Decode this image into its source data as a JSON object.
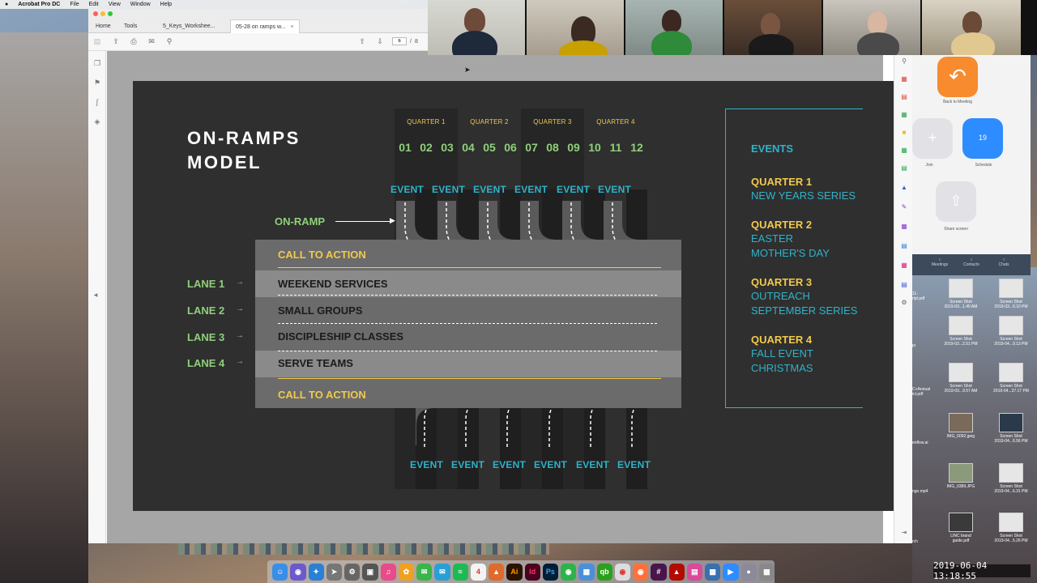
{
  "menubar": {
    "app": "Acrobat Pro DC",
    "items": [
      "File",
      "Edit",
      "View",
      "Window",
      "Help"
    ]
  },
  "acrobat": {
    "tabs": [
      {
        "label": "Home"
      },
      {
        "label": "Tools"
      },
      {
        "label": "5_Keys_Workshee..."
      },
      {
        "label": "05-28 on ramps w..."
      }
    ],
    "close_glyph": "×",
    "pager": {
      "current": "6",
      "separator": "/",
      "total": "8"
    }
  },
  "slide": {
    "title_line1": "ON-RAMPS",
    "title_line2": "MODEL",
    "quarters": [
      "QUARTER 1",
      "QUARTER 2",
      "QUARTER 3",
      "QUARTER 4"
    ],
    "months": [
      "01",
      "02",
      "03",
      "04",
      "05",
      "06",
      "07",
      "08",
      "09",
      "10",
      "11",
      "12"
    ],
    "event_label": "EVENT",
    "onramp_label": "ON-RAMP",
    "cta_top": "CALL TO ACTION",
    "cta_bottom": "CALL TO ACTION",
    "lanes": [
      {
        "label": "LANE 1",
        "name": "WEEKEND SERVICES"
      },
      {
        "label": "LANE 2",
        "name": "SMALL GROUPS"
      },
      {
        "label": "LANE 3",
        "name": "DISCIPLESHIP CLASSES"
      },
      {
        "label": "LANE 4",
        "name": "SERVE TEAMS"
      }
    ],
    "events_panel": {
      "title": "EVENTS",
      "quarters": [
        {
          "q": "QUARTER 1",
          "items": [
            "NEW YEARS SERIES"
          ]
        },
        {
          "q": "QUARTER 2",
          "items": [
            "EASTER",
            "MOTHER'S DAY"
          ]
        },
        {
          "q": "QUARTER 3",
          "items": [
            "OUTREACH",
            "SEPTEMBER SERIES"
          ]
        },
        {
          "q": "QUARTER 4",
          "items": [
            "FALL EVENT",
            "CHRISTMAS"
          ]
        }
      ]
    }
  },
  "zoom": {
    "back_label": "Back to Meeting",
    "join_label": "Join",
    "schedule_label": "Schedule",
    "schedule_day": "19",
    "share_label": "Share screen",
    "footer": [
      "Meetings",
      "Contacts",
      "Chats"
    ]
  },
  "desktop_icons": [
    {
      "line1": "Screen Shot",
      "line2": "2019-03...1.40 AM"
    },
    {
      "line1": "Screen Shot",
      "line2": "2019-03...0.10 PM"
    },
    {
      "line1": "Screen Shot",
      "line2": "2019-03...2.51 PM"
    },
    {
      "line1": "Screen Shot",
      "line2": "2019-04...9.13 PM"
    },
    {
      "line1": "Screen Shot",
      "line2": "2019-03...9.57 AM"
    },
    {
      "line1": "Screen Shot",
      "line2": "2019-04...37.17 PM"
    },
    {
      "line1": "IMG_6092.jpeg",
      "line2": ""
    },
    {
      "line1": "Screen Shot",
      "line2": "2019-04...6.56 PM"
    },
    {
      "line1": "IMG_0389.JPG",
      "line2": ""
    },
    {
      "line1": "Screen Shot",
      "line2": "2019-04...6.31 PM"
    },
    {
      "line1": "LINC brand",
      "line2": "guide.pdf"
    },
    {
      "line1": "Screen Shot",
      "line2": "2019-04...5.26 PM"
    }
  ],
  "desktop_partial": [
    "11-",
    "ript.pdf",
    "pi",
    "C+Annual",
    "ict.pdf",
    "enflow.ai",
    "ngo.mp4",
    "rch"
  ],
  "clock": "2019-06-04 13:18:55",
  "colors": {
    "accent_yellow": "#f2c94c",
    "accent_teal": "#2fb3c9",
    "accent_green": "#8fd07a",
    "slide_bg": "#2f2f2f"
  }
}
